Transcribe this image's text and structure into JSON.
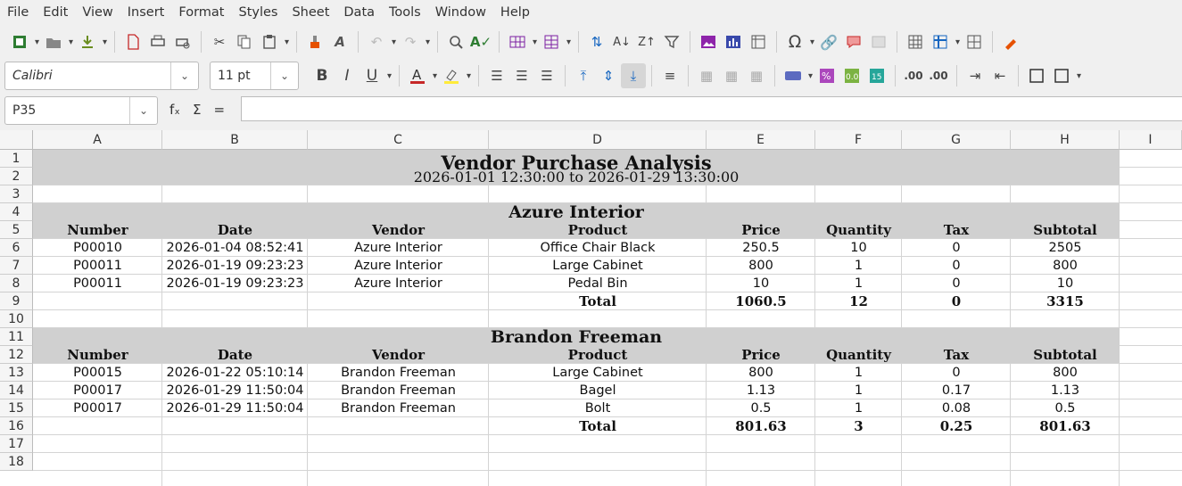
{
  "menu": [
    "File",
    "Edit",
    "View",
    "Insert",
    "Format",
    "Styles",
    "Sheet",
    "Data",
    "Tools",
    "Window",
    "Help"
  ],
  "font_name": "Calibri",
  "font_size": "11 pt",
  "name_box": "P35",
  "formula_symbols": {
    "fx": "fₓ",
    "sum": "Σ",
    "eq": "="
  },
  "columns": [
    "A",
    "B",
    "C",
    "D",
    "E",
    "F",
    "G",
    "H",
    "I"
  ],
  "rows": [
    "1",
    "2",
    "3",
    "4",
    "5",
    "6",
    "7",
    "8",
    "9",
    "10",
    "11",
    "12",
    "13",
    "14",
    "15",
    "16",
    "17",
    "18"
  ],
  "report": {
    "title": "Vendor Purchase Analysis",
    "range": "2026-01-01 12:30:00 to 2026-01-29 13:30:00"
  },
  "headers": [
    "Number",
    "Date",
    "Vendor",
    "Product",
    "Price",
    "Quantity",
    "Tax",
    "Subtotal"
  ],
  "groups": [
    {
      "name": "Azure Interior",
      "rows": [
        [
          "P00010",
          "2026-01-04 08:52:41",
          "Azure Interior",
          "Office Chair Black",
          "250.5",
          "10",
          "0",
          "2505"
        ],
        [
          "P00011",
          "2026-01-19 09:23:23",
          "Azure Interior",
          "Large Cabinet",
          "800",
          "1",
          "0",
          "800"
        ],
        [
          "P00011",
          "2026-01-19 09:23:23",
          "Azure Interior",
          "Pedal Bin",
          "10",
          "1",
          "0",
          "10"
        ]
      ],
      "total": {
        "label": "Total",
        "price": "1060.5",
        "quantity": "12",
        "tax": "0",
        "subtotal": "3315"
      }
    },
    {
      "name": "Brandon Freeman",
      "rows": [
        [
          "P00015",
          "2026-01-22 05:10:14",
          "Brandon Freeman",
          "Large Cabinet",
          "800",
          "1",
          "0",
          "800"
        ],
        [
          "P00017",
          "2026-01-29 11:50:04",
          "Brandon Freeman",
          "Bagel",
          "1.13",
          "1",
          "0.17",
          "1.13"
        ],
        [
          "P00017",
          "2026-01-29 11:50:04",
          "Brandon Freeman",
          "Bolt",
          "0.5",
          "1",
          "0.08",
          "0.5"
        ]
      ],
      "total": {
        "label": "Total",
        "price": "801.63",
        "quantity": "3",
        "tax": "0.25",
        "subtotal": "801.63"
      }
    }
  ]
}
